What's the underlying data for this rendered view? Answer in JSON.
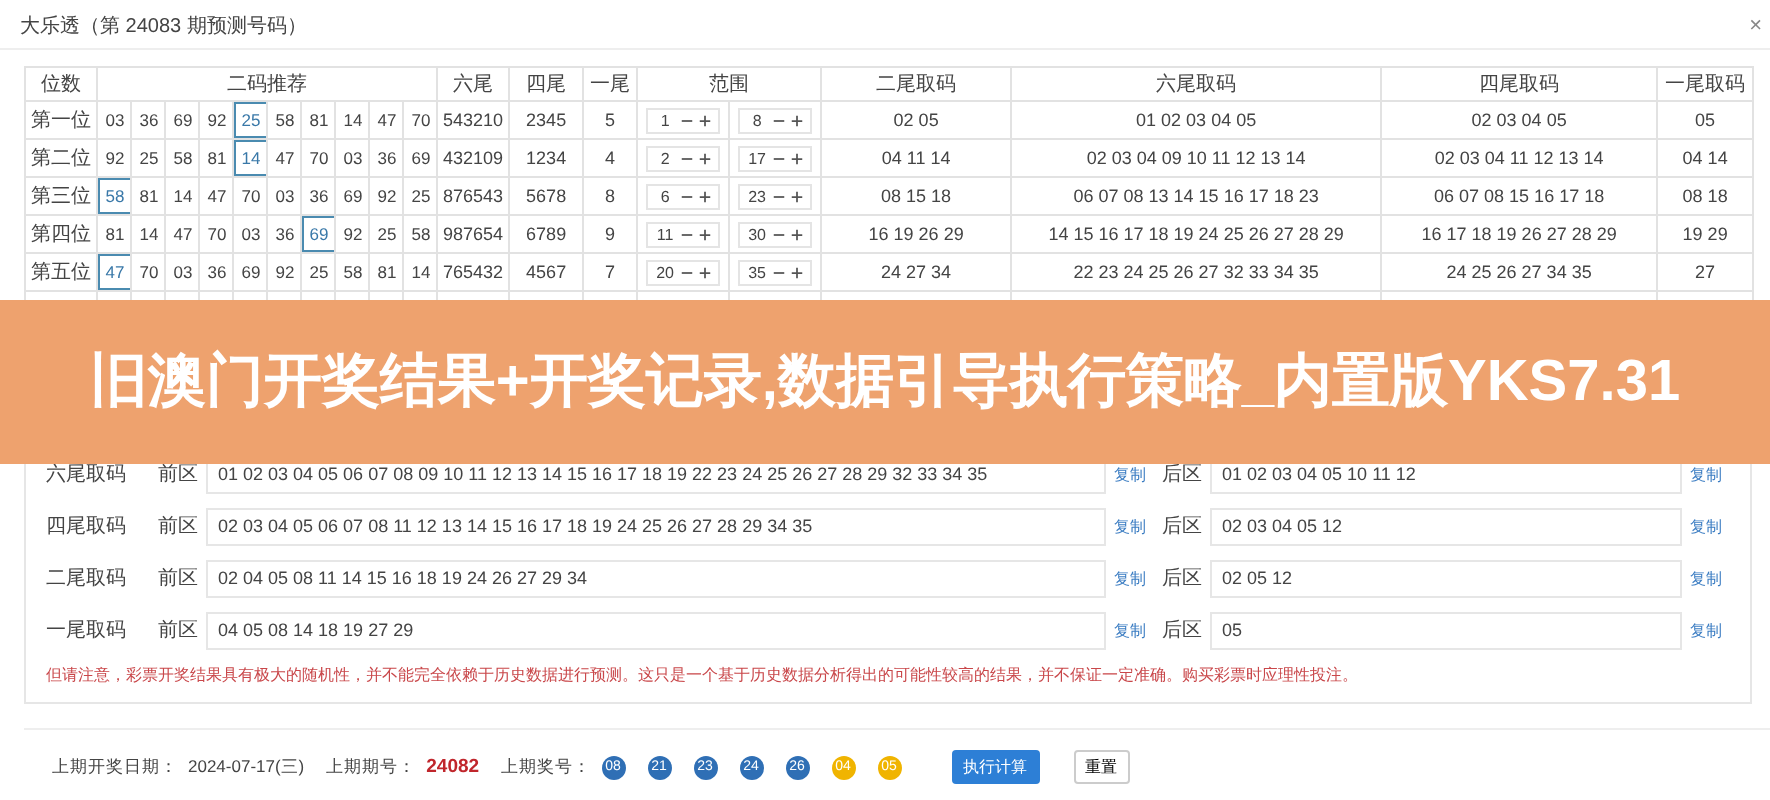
{
  "header": {
    "title": "大乐透（第 24083 期预测号码）",
    "close": "×"
  },
  "table": {
    "columns": [
      "位数",
      "二码推荐",
      "六尾",
      "四尾",
      "一尾",
      "范围",
      "二尾取码",
      "六尾取码",
      "四尾取码",
      "一尾取码"
    ],
    "rows": [
      {
        "label": "第一位",
        "picks": [
          {
            "n": "03",
            "selected": false
          },
          {
            "n": "36",
            "selected": false
          },
          {
            "n": "69",
            "selected": false
          },
          {
            "n": "92",
            "selected": false
          },
          {
            "n": "25",
            "selected": true
          },
          {
            "n": "58",
            "selected": false
          },
          {
            "n": "81",
            "selected": false
          },
          {
            "n": "14",
            "selected": false
          },
          {
            "n": "47",
            "selected": false
          },
          {
            "n": "70",
            "selected": false
          }
        ],
        "six": "543210",
        "four": "2345",
        "one": "5",
        "range_low": "1",
        "range_high": "8",
        "er_ma": "02 05",
        "liu_ma": "01 02 03 04 05",
        "si_ma": "02 03 04 05",
        "yi_ma": "05"
      },
      {
        "label": "第二位",
        "picks": [
          {
            "n": "92",
            "selected": false
          },
          {
            "n": "25",
            "selected": false
          },
          {
            "n": "58",
            "selected": false
          },
          {
            "n": "81",
            "selected": false
          },
          {
            "n": "14",
            "selected": true
          },
          {
            "n": "47",
            "selected": false
          },
          {
            "n": "70",
            "selected": false
          },
          {
            "n": "03",
            "selected": false
          },
          {
            "n": "36",
            "selected": false
          },
          {
            "n": "69",
            "selected": false
          }
        ],
        "six": "432109",
        "four": "1234",
        "one": "4",
        "range_low": "2",
        "range_high": "17",
        "er_ma": "04 11 14",
        "liu_ma": "02 03 04 09 10 11 12 13 14",
        "si_ma": "02 03 04 11 12 13 14",
        "yi_ma": "04 14"
      },
      {
        "label": "第三位",
        "picks": [
          {
            "n": "58",
            "selected": true
          },
          {
            "n": "81",
            "selected": false
          },
          {
            "n": "14",
            "selected": false
          },
          {
            "n": "47",
            "selected": false
          },
          {
            "n": "70",
            "selected": false
          },
          {
            "n": "03",
            "selected": false
          },
          {
            "n": "36",
            "selected": false
          },
          {
            "n": "69",
            "selected": false
          },
          {
            "n": "92",
            "selected": false
          },
          {
            "n": "25",
            "selected": false
          }
        ],
        "six": "876543",
        "four": "5678",
        "one": "8",
        "range_low": "6",
        "range_high": "23",
        "er_ma": "08 15 18",
        "liu_ma": "06 07 08 13 14 15 16 17 18 23",
        "si_ma": "06 07 08 15 16 17 18",
        "yi_ma": "08 18"
      },
      {
        "label": "第四位",
        "picks": [
          {
            "n": "81",
            "selected": false
          },
          {
            "n": "14",
            "selected": false
          },
          {
            "n": "47",
            "selected": false
          },
          {
            "n": "70",
            "selected": false
          },
          {
            "n": "03",
            "selected": false
          },
          {
            "n": "36",
            "selected": false
          },
          {
            "n": "69",
            "selected": true
          },
          {
            "n": "92",
            "selected": false
          },
          {
            "n": "25",
            "selected": false
          },
          {
            "n": "58",
            "selected": false
          }
        ],
        "six": "987654",
        "four": "6789",
        "one": "9",
        "range_low": "11",
        "range_high": "30",
        "er_ma": "16 19 26 29",
        "liu_ma": "14 15 16 17 18 19 24 25 26 27 28 29",
        "si_ma": "16 17 18 19 26 27 28 29",
        "yi_ma": "19 29"
      },
      {
        "label": "第五位",
        "picks": [
          {
            "n": "47",
            "selected": true
          },
          {
            "n": "70",
            "selected": false
          },
          {
            "n": "03",
            "selected": false
          },
          {
            "n": "36",
            "selected": false
          },
          {
            "n": "69",
            "selected": false
          },
          {
            "n": "92",
            "selected": false
          },
          {
            "n": "25",
            "selected": false
          },
          {
            "n": "58",
            "selected": false
          },
          {
            "n": "81",
            "selected": false
          },
          {
            "n": "14",
            "selected": false
          }
        ],
        "six": "765432",
        "four": "4567",
        "one": "7",
        "range_low": "20",
        "range_high": "35",
        "er_ma": "24 27 34",
        "liu_ma": "22 23 24 25 26 27 32 33 34 35",
        "si_ma": "24 25 26 27 34 35",
        "yi_ma": "27"
      }
    ]
  },
  "banner": "旧澳门开奖结果+开奖记录,数据引导执行策略_内置版YKS7.31",
  "panel": {
    "rows": [
      {
        "label": "六尾取码",
        "front_label": "前区",
        "front": "01 02 03 04 05 06 07 08 09 10 11 12 13 14 15 16 17 18 19 22 23 24 25 26 27 28 29 32 33 34 35",
        "copy1": "复制",
        "back_label": "后区",
        "back": "01 02 03 04 05 10 11 12",
        "copy2": "复制"
      },
      {
        "label": "四尾取码",
        "front_label": "前区",
        "front": "02 03 04 05 06 07 08 11 12 13 14 15 16 17 18 19 24 25 26 27 28 29 34 35",
        "copy1": "复制",
        "back_label": "后区",
        "back": "02 03 04 05 12",
        "copy2": "复制"
      },
      {
        "label": "二尾取码",
        "front_label": "前区",
        "front": "02 04 05 08 11 14 15 16 18 19 24 26 27 29 34",
        "copy1": "复制",
        "back_label": "后区",
        "back": "02 05 12",
        "copy2": "复制"
      },
      {
        "label": "一尾取码",
        "front_label": "前区",
        "front": "04 05 08 14 18 19 27 29",
        "copy1": "复制",
        "back_label": "后区",
        "back": "05",
        "copy2": "复制"
      }
    ],
    "notice": "但请注意，彩票开奖结果具有极大的随机性，并不能完全依赖于历史数据进行预测。这只是一个基于历史数据分析得出的可能性较高的结果，并不保证一定准确。购买彩票时应理性投注。"
  },
  "footer": {
    "date_label": "上期开奖日期：",
    "date": "2024-07-17(三)",
    "issue_label": "上期期号：",
    "issue": "24082",
    "numbers_label": "上期奖号：",
    "balls": [
      {
        "n": "08",
        "color": "#2f6fb5"
      },
      {
        "n": "21",
        "color": "#2f6fb5"
      },
      {
        "n": "23",
        "color": "#2f6fb5"
      },
      {
        "n": "24",
        "color": "#2f6fb5"
      },
      {
        "n": "26",
        "color": "#2f6fb5"
      },
      {
        "n": "04",
        "color": "#f0b400"
      },
      {
        "n": "05",
        "color": "#f0b400"
      }
    ],
    "run": "执行计算",
    "reset": "重置"
  }
}
